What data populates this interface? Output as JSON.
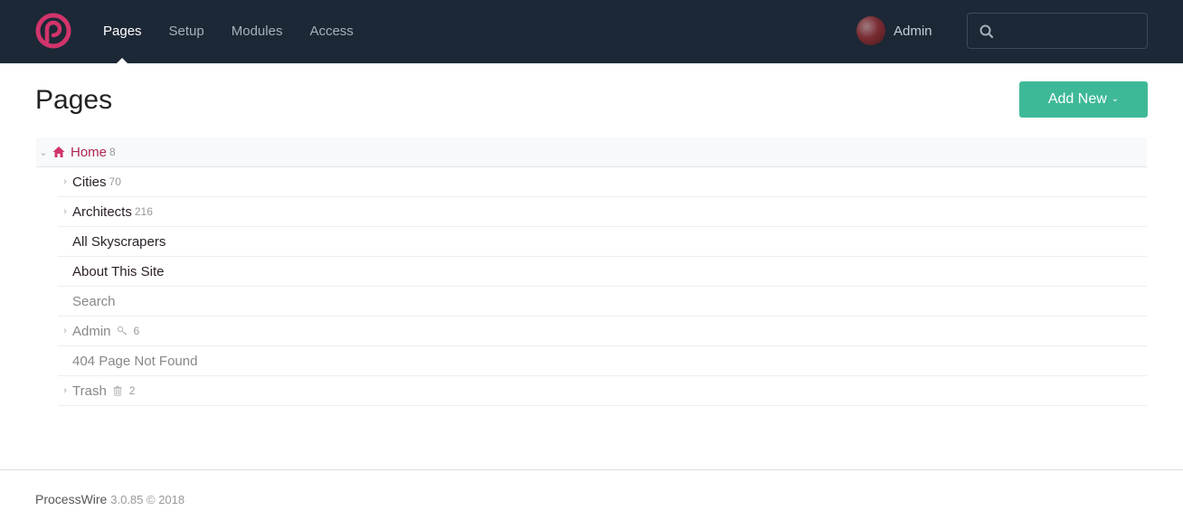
{
  "app": {
    "name": "ProcessWire",
    "brand_color": "#d1346b"
  },
  "nav": {
    "items": [
      {
        "label": "Pages",
        "active": true
      },
      {
        "label": "Setup",
        "active": false
      },
      {
        "label": "Modules",
        "active": false
      },
      {
        "label": "Access",
        "active": false
      }
    ]
  },
  "user": {
    "name": "Admin"
  },
  "search": {
    "placeholder": "",
    "value": ""
  },
  "page": {
    "title": "Pages",
    "add_new_label": "Add New",
    "add_new_color": "#3eb998"
  },
  "tree": {
    "root": {
      "label": "Home",
      "count": "8",
      "icon": "home-icon"
    },
    "children": [
      {
        "label": "Cities",
        "count": "70",
        "expandable": true,
        "muted": false
      },
      {
        "label": "Architects",
        "count": "216",
        "expandable": true,
        "muted": false
      },
      {
        "label": "All Skyscrapers",
        "count": "",
        "expandable": false,
        "muted": false
      },
      {
        "label": "About This Site",
        "count": "",
        "expandable": false,
        "muted": false
      },
      {
        "label": "Search",
        "count": "",
        "expandable": false,
        "muted": true
      },
      {
        "label": "Admin",
        "count": "6",
        "expandable": true,
        "muted": true,
        "icon": "key-icon"
      },
      {
        "label": "404 Page Not Found",
        "count": "",
        "expandable": false,
        "muted": true
      },
      {
        "label": "Trash",
        "count": "2",
        "expandable": true,
        "muted": true,
        "icon": "trash-icon"
      }
    ]
  },
  "footer": {
    "product": "ProcessWire",
    "version": "3.0.85 © 2018"
  }
}
